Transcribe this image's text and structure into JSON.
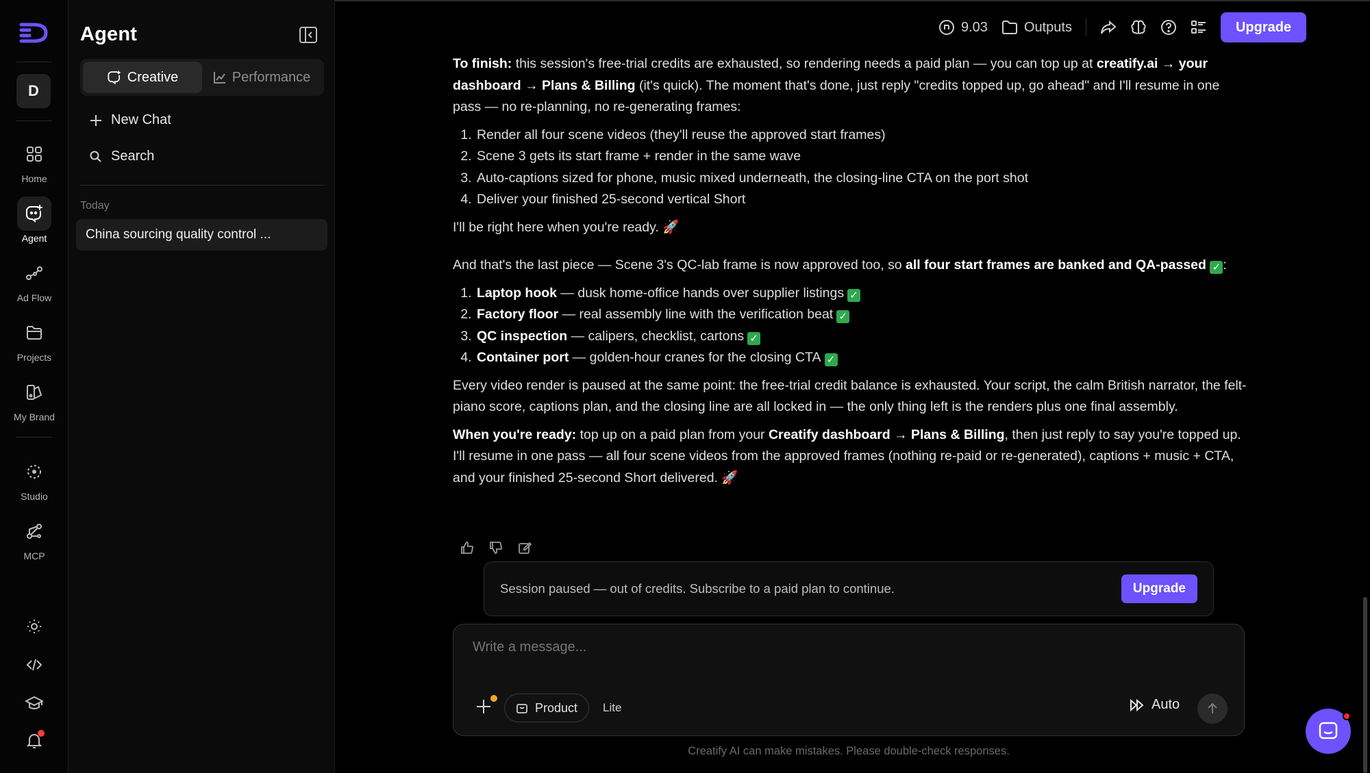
{
  "rail": {
    "avatar_initial": "D",
    "items": [
      {
        "label": "Home",
        "icon": "grid-icon"
      },
      {
        "label": "Agent",
        "icon": "chat-sparkle-icon"
      },
      {
        "label": "Ad Flow",
        "icon": "flow-icon"
      },
      {
        "label": "Projects",
        "icon": "folder-icon"
      },
      {
        "label": "My Brand",
        "icon": "brand-icon"
      },
      {
        "label": "Studio",
        "icon": "studio-icon"
      },
      {
        "label": "MCP",
        "icon": "mcp-icon"
      }
    ],
    "active": "Agent"
  },
  "panel": {
    "title": "Agent",
    "tabs": [
      {
        "label": "Creative",
        "active": true
      },
      {
        "label": "Performance",
        "active": false
      }
    ],
    "new_chat": "New Chat",
    "search": "Search",
    "section_label": "Today",
    "chats": [
      {
        "title": "China sourcing quality control ..."
      }
    ]
  },
  "topbar": {
    "credits": "9.03",
    "outputs": "Outputs",
    "upgrade": "Upgrade"
  },
  "message": {
    "p1_bold": "To finish:",
    "p1_a": " this session's free-trial credits are exhausted, so rendering needs a paid plan — you can top up at ",
    "p1_bold2": "creatify.ai → your dashboard → Plans & Billing",
    "p1_b": " (it's quick). The moment that's done, just reply \"credits topped up, go ahead\" and I'll resume in one pass — no re-planning, no re-generating frames:",
    "list1": [
      "Render all four scene videos (they'll reuse the approved start frames)",
      "Scene 3 gets its start frame + render in the same wave",
      "Auto-captions sized for phone, music mixed underneath, the closing-line CTA on the port shot",
      "Deliver your finished 25-second vertical Short"
    ],
    "p2": "I'll be right here when you're ready. 🚀",
    "p3_a": "And that's the last piece — Scene 3's QC-lab frame is now approved too, so ",
    "p3_bold": "all four start frames are banked and QA-passed",
    "p3_b": ":",
    "list2": [
      {
        "bold": "Laptop hook",
        "rest": " — dusk home-office hands over supplier listings"
      },
      {
        "bold": "Factory floor",
        "rest": " — real assembly line with the verification beat"
      },
      {
        "bold": "QC inspection",
        "rest": " — calipers, checklist, cartons"
      },
      {
        "bold": "Container port",
        "rest": " — golden-hour cranes for the closing CTA"
      }
    ],
    "check_glyph": "✓",
    "p4": "Every video render is paused at the same point: the free-trial credit balance is exhausted. Your script, the calm British narrator, the felt-piano score, captions plan, and the closing line are all locked in — the only thing left is the renders plus one final assembly.",
    "p5_bold": "When you're ready:",
    "p5_a": " top up on a paid plan from your ",
    "p5_bold2": "Creatify dashboard → Plans & Billing",
    "p5_b": ", then just reply to say you're topped up. I'll resume in one pass — all four scene videos from the approved frames (nothing re-paid or re-generated), captions + music + CTA, and your finished 25-second Short delivered. 🚀"
  },
  "paused_banner": {
    "text": "Session paused — out of credits. Subscribe to a paid plan to continue.",
    "button": "Upgrade"
  },
  "composer": {
    "placeholder": "Write a message...",
    "product": "Product",
    "lite": "Lite",
    "auto": "Auto"
  },
  "disclaimer": "Creatify AI can make mistakes. Please double-check responses.",
  "colors": {
    "accent": "#6e51ff",
    "background": "#000000",
    "panel": "#0b0b0b",
    "check": "#2fa84f"
  }
}
